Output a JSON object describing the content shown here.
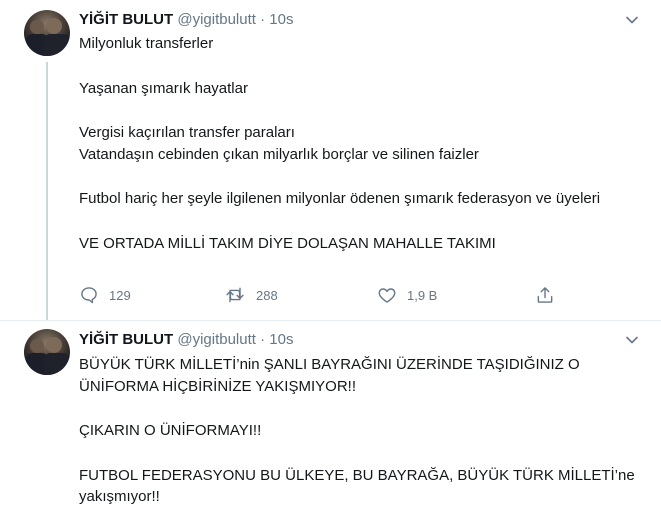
{
  "tweets": [
    {
      "name": "YİĞİT BULUT",
      "handle": "@yigitbulutt",
      "separator": "·",
      "time": "10s",
      "paragraphs": [
        "Milyonluk transferler",
        "Yaşanan şımarık hayatlar",
        "Vergisi kaçırılan transfer paraları",
        "Vatandaşın cebinden çıkan milyarlık borçlar ve silinen faizler",
        "Futbol hariç her şeyle ilgilenen milyonlar ödenen şımarık federasyon ve üyeleri",
        "VE ORTADA MİLLİ TAKIM DİYE DOLAŞAN MAHALLE TAKIMI"
      ],
      "actions": {
        "replies": "129",
        "retweets": "288",
        "likes": "1,9 B"
      },
      "icons": [
        "reply-icon",
        "retweet-icon",
        "like-icon",
        "share-icon",
        "chevron-down-icon"
      ]
    },
    {
      "name": "YİĞİT BULUT",
      "handle": "@yigitbulutt",
      "separator": "·",
      "time": "10s",
      "paragraphs": [
        "BÜYÜK TÜRK MİLLETİ’nin ŞANLI BAYRAĞINI ÜZERİNDE TAŞIDIĞINIZ O ÜNİFORMA HİÇBİRİNİZE YAKIŞMIYOR!!",
        "ÇIKARIN O ÜNİFORMAYI!!",
        "FUTBOL FEDERASYONU BU ÜLKEYE, BU BAYRAĞA, BÜYÜK TÜRK MİLLETİ’ne yakışmıyor!!"
      ]
    }
  ],
  "colors": {
    "text": "#14171a",
    "secondary": "#657786",
    "thread_line": "#ccd6dd",
    "divider": "#e6ecf0"
  }
}
